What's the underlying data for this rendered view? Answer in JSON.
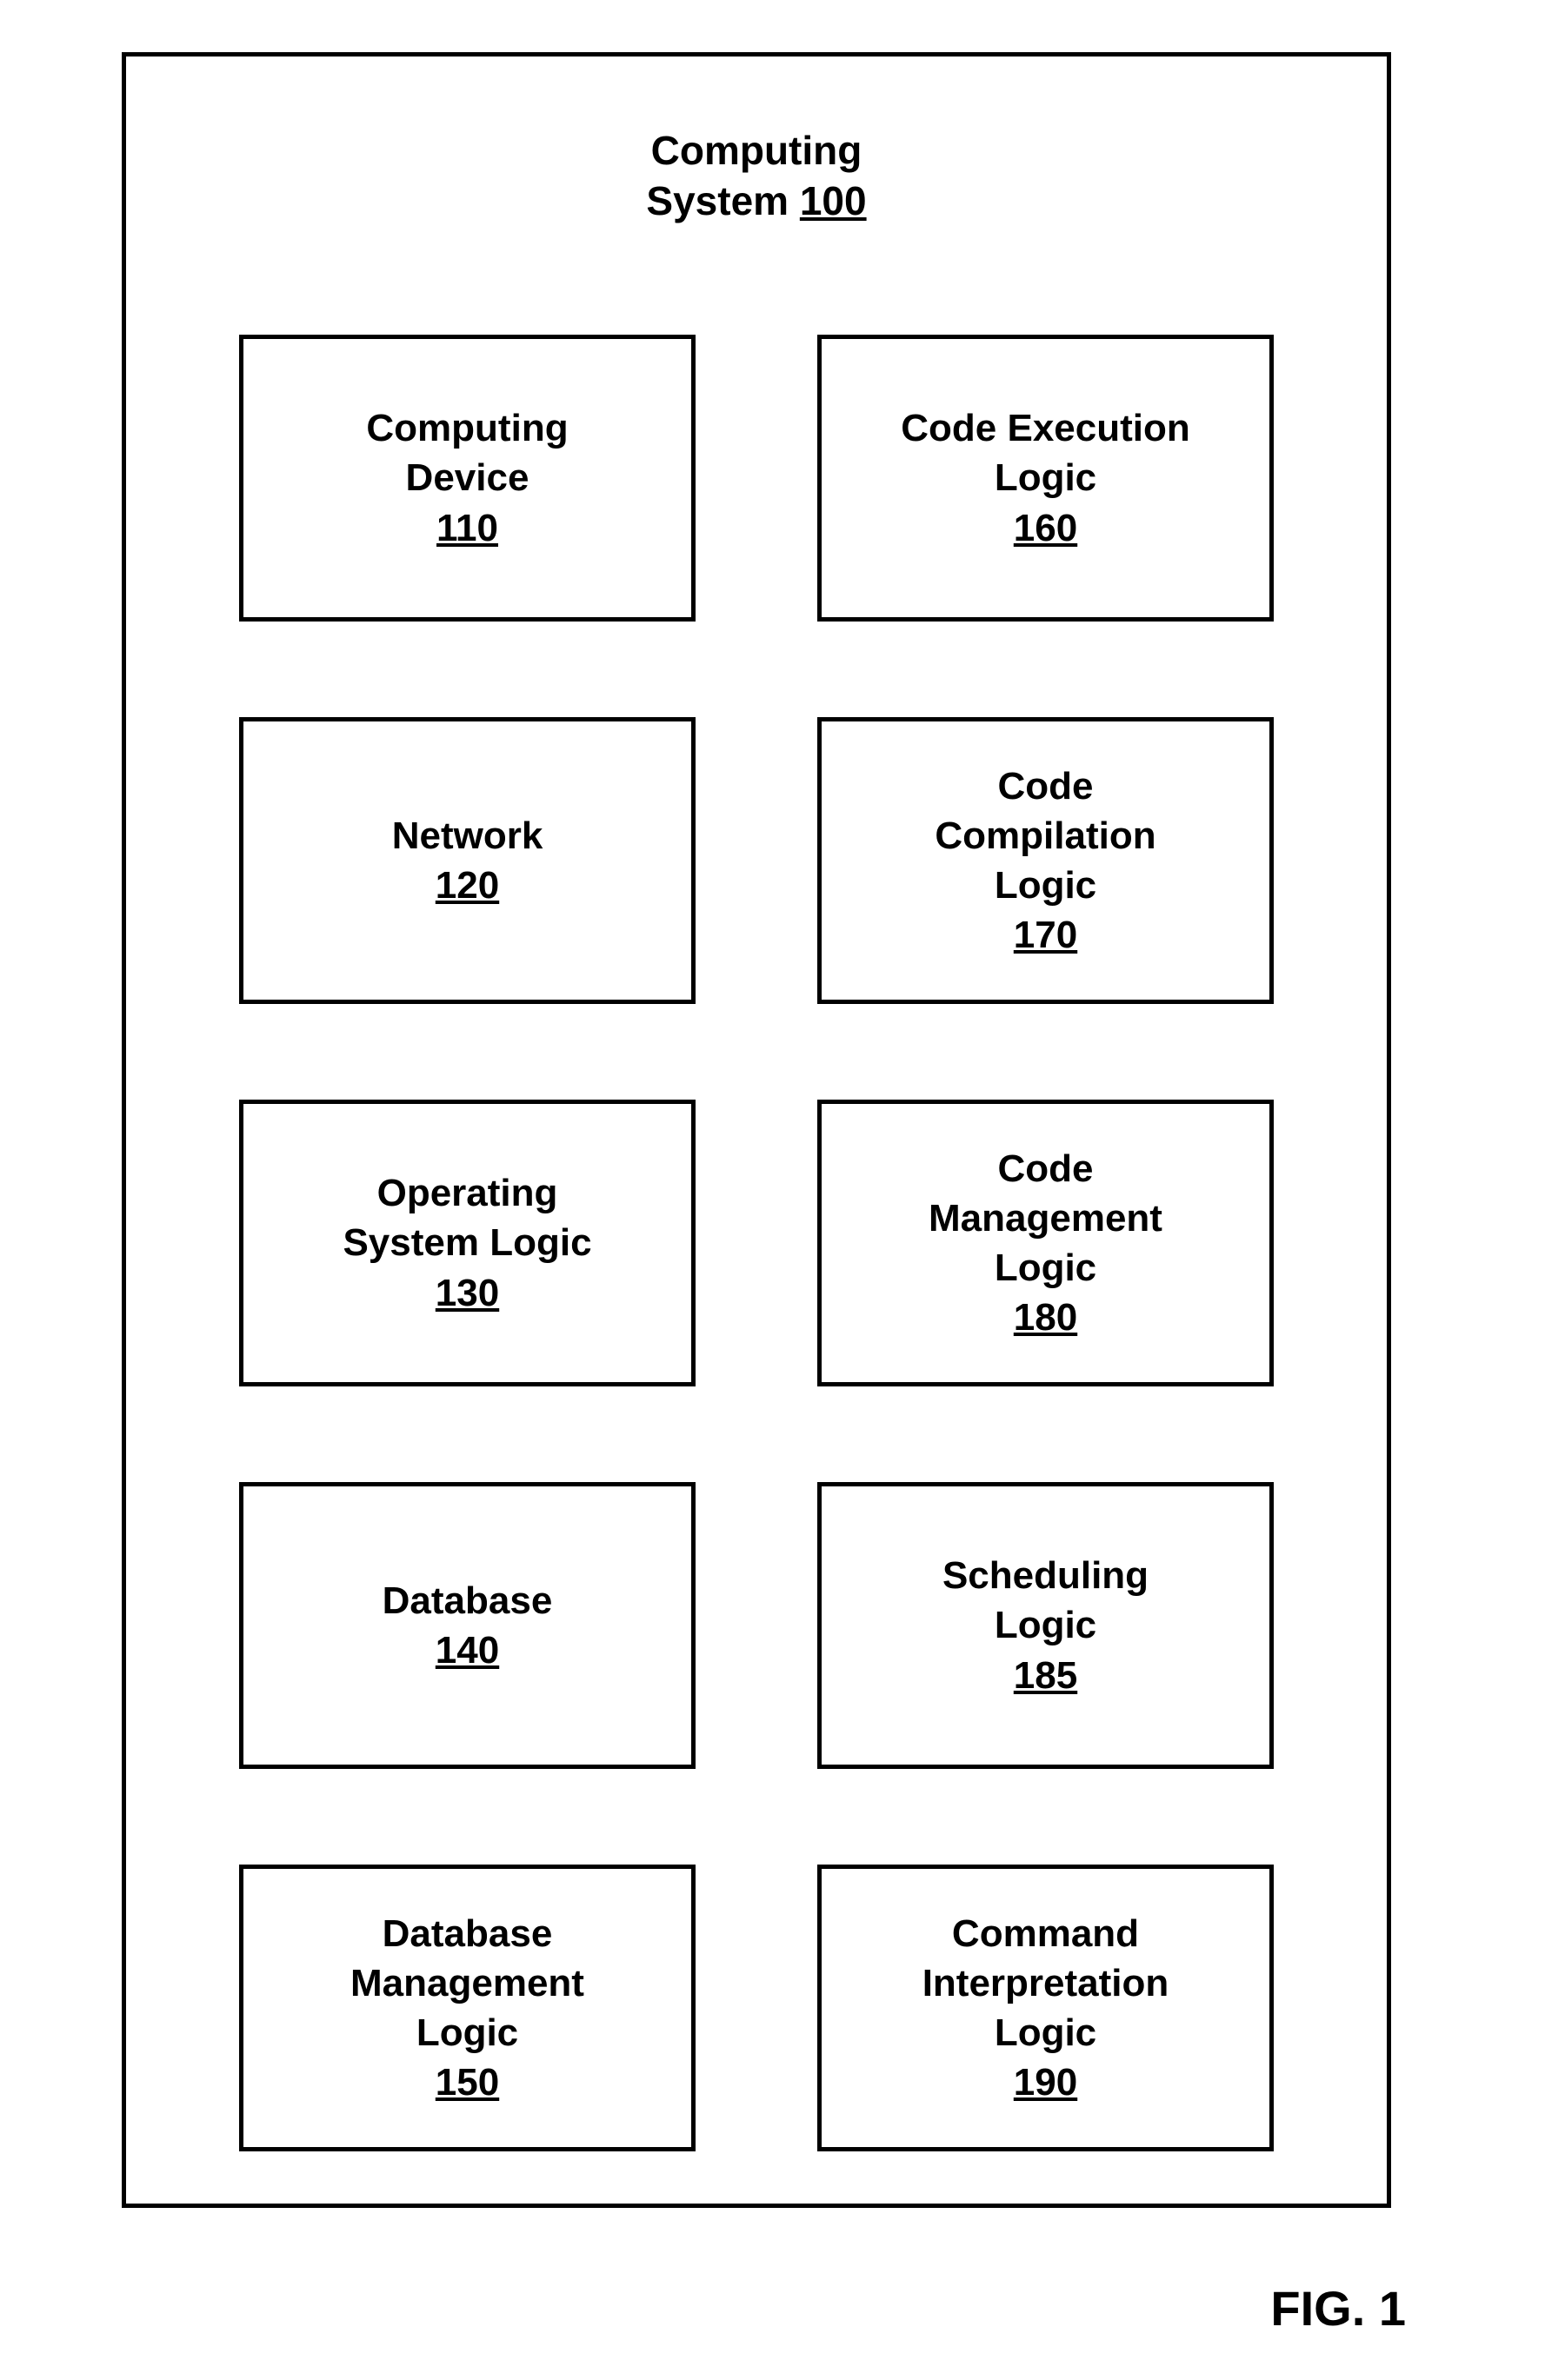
{
  "title": {
    "line1": "Computing",
    "line2_prefix": "System ",
    "line2_num": "100"
  },
  "figure_label": "FIG. 1",
  "blocks": [
    {
      "label_lines": [
        "Computing",
        "Device"
      ],
      "num": "110"
    },
    {
      "label_lines": [
        "Code Execution",
        "Logic"
      ],
      "num": "160"
    },
    {
      "label_lines": [
        "Network"
      ],
      "num": "120"
    },
    {
      "label_lines": [
        "Code",
        "Compilation",
        "Logic"
      ],
      "num": "170"
    },
    {
      "label_lines": [
        "Operating",
        "System Logic"
      ],
      "num": "130"
    },
    {
      "label_lines": [
        "Code",
        "Management",
        "Logic"
      ],
      "num": "180"
    },
    {
      "label_lines": [
        "Database"
      ],
      "num": "140"
    },
    {
      "label_lines": [
        "Scheduling",
        "Logic"
      ],
      "num": "185"
    },
    {
      "label_lines": [
        "Database",
        "Management",
        "Logic"
      ],
      "num": "150"
    },
    {
      "label_lines": [
        "Command",
        "Interpretation",
        "Logic"
      ],
      "num": "190"
    }
  ]
}
